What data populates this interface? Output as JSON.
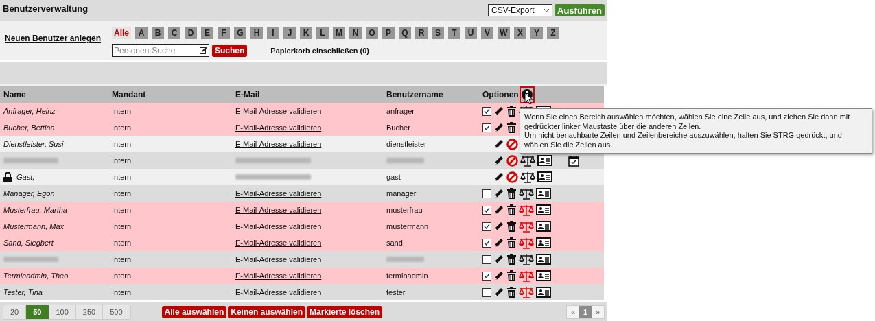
{
  "title": "Benutzerverwaltung",
  "export": {
    "value": "CSV-Export",
    "button": "Ausführen"
  },
  "new_user_link": "Neuen Benutzer anlegen",
  "letters": [
    {
      "label": "Alle",
      "selected": true
    },
    {
      "label": "A",
      "selected": false
    },
    {
      "label": "B",
      "selected": false
    },
    {
      "label": "C",
      "selected": false
    },
    {
      "label": "D",
      "selected": false
    },
    {
      "label": "E",
      "selected": false
    },
    {
      "label": "F",
      "selected": false
    },
    {
      "label": "G",
      "selected": false
    },
    {
      "label": "H",
      "selected": false
    },
    {
      "label": "I",
      "selected": false
    },
    {
      "label": "J",
      "selected": false
    },
    {
      "label": "K",
      "selected": false
    },
    {
      "label": "L",
      "selected": false
    },
    {
      "label": "M",
      "selected": false
    },
    {
      "label": "N",
      "selected": false
    },
    {
      "label": "O",
      "selected": false
    },
    {
      "label": "P",
      "selected": false
    },
    {
      "label": "Q",
      "selected": false
    },
    {
      "label": "R",
      "selected": false
    },
    {
      "label": "S",
      "selected": false
    },
    {
      "label": "T",
      "selected": false
    },
    {
      "label": "U",
      "selected": false
    },
    {
      "label": "V",
      "selected": false
    },
    {
      "label": "W",
      "selected": false
    },
    {
      "label": "X",
      "selected": false
    },
    {
      "label": "Y",
      "selected": false
    },
    {
      "label": "Z",
      "selected": false
    }
  ],
  "search": {
    "placeholder": "Personen-Suche",
    "button": "Suchen"
  },
  "trash_filter": "Papierkorb einschließen (0)",
  "columns": [
    "Name",
    "Mandant",
    "E-Mail",
    "Benutzername",
    "Optionen"
  ],
  "rows": [
    {
      "name": "Anfrager, Heinz",
      "mandant": "Intern",
      "email": "E-Mail-Adresse validieren",
      "username": "anfrager",
      "checkable": true,
      "checked": true,
      "deletable": true,
      "scale_alert": false,
      "locked": false,
      "calendar": false
    },
    {
      "name": "Bucher, Bettina",
      "mandant": "Intern",
      "email": "E-Mail-Adresse validieren",
      "username": "Bucher",
      "checkable": true,
      "checked": true,
      "deletable": true,
      "locked": false
    },
    {
      "name": "Dienstleister, Susi",
      "mandant": "Intern",
      "email": "E-Mail-Adresse validieren",
      "username": "dienstleister",
      "checkable": false,
      "checked": false,
      "deletable": false,
      "locked": false
    },
    {
      "blurred": {
        "name": true,
        "email": true,
        "username": true
      },
      "mandant": "Intern",
      "checkable": false,
      "checked": false,
      "deletable": false,
      "scale_alert": false,
      "locked": false,
      "calendar": true
    },
    {
      "name": "Gast,",
      "blurred": {
        "email": true
      },
      "mandant": "Intern",
      "username": "gast",
      "checkable": false,
      "checked": false,
      "deletable": false,
      "scale_alert": false,
      "locked": true,
      "calendar": false
    },
    {
      "name": "Manager, Egon",
      "mandant": "Intern",
      "email": "E-Mail-Adresse validieren",
      "username": "manager",
      "checkable": true,
      "checked": false,
      "deletable": true,
      "scale_alert": false,
      "locked": false,
      "calendar": false
    },
    {
      "name": "Musterfrau, Martha",
      "mandant": "Intern",
      "email": "E-Mail-Adresse validieren",
      "username": "musterfrau",
      "checkable": true,
      "checked": true,
      "deletable": true,
      "scale_alert": true,
      "locked": false,
      "calendar": false
    },
    {
      "name": "Mustermann, Max",
      "mandant": "Intern",
      "email": "E-Mail-Adresse validieren",
      "username": "mustermann",
      "checkable": true,
      "checked": true,
      "deletable": true,
      "scale_alert": true,
      "locked": false,
      "calendar": false
    },
    {
      "name": "Sand, Siegbert",
      "mandant": "Intern",
      "email": "E-Mail-Adresse validieren",
      "username": "sand",
      "checkable": true,
      "checked": true,
      "deletable": true,
      "scale_alert": true,
      "locked": false,
      "calendar": false
    },
    {
      "blurred": {
        "name": true,
        "username": true
      },
      "mandant": "Intern",
      "email": "E-Mail-Adresse validieren",
      "checkable": true,
      "checked": false,
      "deletable": true,
      "scale_alert": false,
      "locked": false,
      "calendar": false
    },
    {
      "name": "Terminadmin, Theo",
      "mandant": "Intern",
      "email": "E-Mail-Adresse validieren",
      "username": "terminadmin",
      "checkable": true,
      "checked": true,
      "deletable": true,
      "scale_alert": true,
      "locked": false,
      "calendar": false
    },
    {
      "name": "Tester, Tina",
      "mandant": "Intern",
      "email": "E-Mail-Adresse validieren",
      "username": "tester",
      "checkable": true,
      "checked": false,
      "deletable": true,
      "scale_alert": true,
      "locked": false,
      "calendar": false
    }
  ],
  "tooltip": [
    "Wenn Sie einen Bereich auswählen möchten, wählen Sie eine Zeile aus, und ziehen Sie dann mit gedrückter linker Maustaste über die anderen Zeilen.",
    "Um nicht benachbarte Zeilen und Zeilenbereiche auszuwählen, halten Sie STRG gedrückt, und wählen Sie die Zeilen aus."
  ],
  "page_sizes": [
    {
      "label": "20",
      "selected": false
    },
    {
      "label": "50",
      "selected": true
    },
    {
      "label": "100",
      "selected": false
    },
    {
      "label": "250",
      "selected": false
    },
    {
      "label": "500",
      "selected": false
    }
  ],
  "actions": [
    "Alle auswählen",
    "Keinen auswählen",
    "Markierte löschen"
  ],
  "pager": {
    "prev": "«",
    "pages": [
      {
        "label": "1",
        "selected": true
      }
    ],
    "next": "»"
  }
}
